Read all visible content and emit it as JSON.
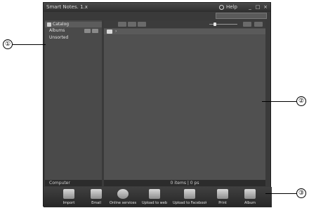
{
  "window": {
    "title": "Smart Notes. 1.x",
    "help_label": "Help",
    "minimize": "_",
    "maximize": "□",
    "close": "×"
  },
  "sidebar": {
    "items": [
      {
        "label": "Catalog"
      },
      {
        "label": "Albums"
      },
      {
        "label": "Unsorted"
      }
    ],
    "footer_label": "Computer"
  },
  "main": {
    "path_label": "›"
  },
  "status_bar": {
    "text": "0 items | 0 ps"
  },
  "bottom_bar": {
    "items": [
      {
        "label": "Import",
        "icon": "import-icon"
      },
      {
        "label": "Email",
        "icon": "email-icon"
      },
      {
        "label": "Online services",
        "icon": "disc-icon"
      },
      {
        "label": "Upload to web",
        "icon": "upload-icon"
      },
      {
        "label": "Upload to Facebook",
        "icon": "facebook-icon"
      },
      {
        "label": "Print",
        "icon": "print-icon"
      },
      {
        "label": "Album",
        "icon": "album-icon"
      }
    ]
  },
  "callouts": {
    "c1": "①",
    "c2": "②",
    "c3": "③"
  }
}
